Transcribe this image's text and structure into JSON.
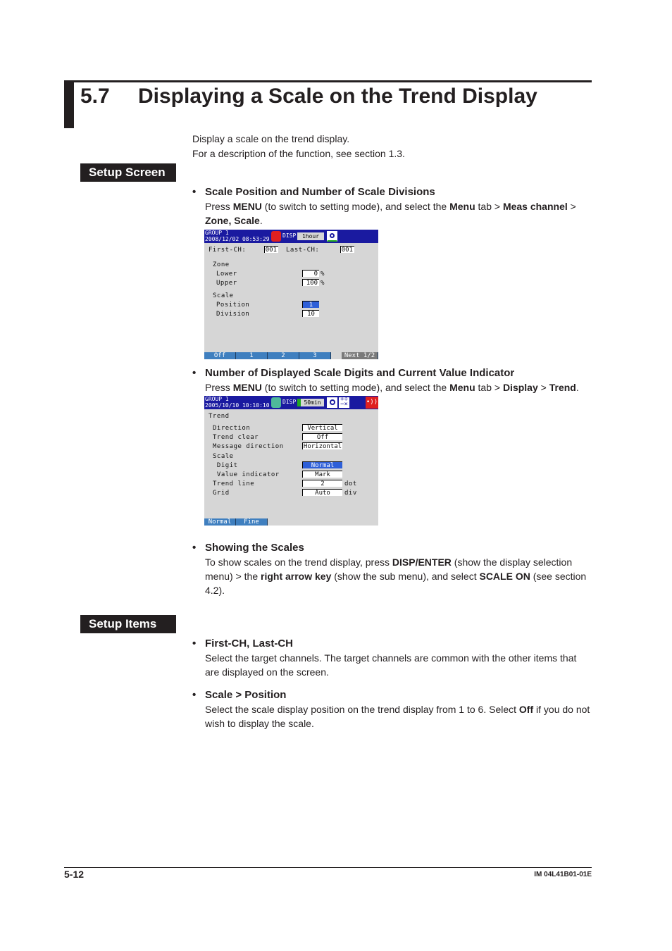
{
  "header": {
    "section_number": "5.7",
    "title": "Displaying a Scale on the Trend Display"
  },
  "intro": [
    "Display a scale on the trend display.",
    "For a description of the function, see section 1.3."
  ],
  "setup_screen": {
    "tag": "Setup Screen",
    "bullets": [
      {
        "heading": "Scale Position and Number of Scale Divisions",
        "text_parts": [
          "Press ",
          "MENU",
          " (to switch to setting mode), and select the ",
          "Menu",
          " tab > ",
          "Meas channel",
          " > ",
          "Zone, Scale",
          "."
        ]
      },
      {
        "heading": "Number of Displayed Scale Digits and Current Value Indicator",
        "text_parts": [
          "Press ",
          "MENU",
          " (to switch to setting mode), and select the ",
          "Menu",
          " tab > ",
          "Display",
          " > ",
          "Trend",
          "."
        ]
      },
      {
        "heading": "Showing the Scales",
        "text_parts": [
          "To show scales on the trend display, press ",
          "DISP/ENTER",
          " (show the display selection menu) > the ",
          "right arrow key",
          " (show the sub menu), and select ",
          "SCALE ON",
          " (see section 4.2)."
        ]
      }
    ]
  },
  "screen1": {
    "group": "GROUP 1",
    "datetime": "2008/12/02 08:53:29",
    "disp_label": "DISP",
    "time_div": "1hour",
    "first_ch_label": "First-CH:",
    "first_ch": "001",
    "last_ch_label": "Last-CH:",
    "last_ch": "001",
    "zone_label": "Zone",
    "lower_label": "Lower",
    "lower_value": "0",
    "upper_label": "Upper",
    "upper_value": "100",
    "percent": "%",
    "scale_label": "Scale",
    "position_label": "Position",
    "position_value": "1",
    "division_label": "Division",
    "division_value": "10",
    "softkeys": [
      "Off",
      "1",
      "2",
      "3",
      "Next 1/2"
    ]
  },
  "screen2": {
    "group": "GROUP 1",
    "datetime": "2005/10/10 10:10:10",
    "disp_label": "DISP",
    "time_div": "50min",
    "trend_label": "Trend",
    "rows": [
      {
        "label": "Direction",
        "value": "Vertical",
        "unit": "",
        "selected": false
      },
      {
        "label": "Trend clear",
        "value": "Off",
        "unit": "",
        "selected": false
      },
      {
        "label": "Message direction",
        "value": "Horizontal",
        "unit": "",
        "selected": false
      },
      {
        "label": "Scale",
        "value": null,
        "unit": "",
        "selected": false
      },
      {
        "label": " Digit",
        "value": "Normal",
        "unit": "",
        "selected": true
      },
      {
        "label": " Value indicator",
        "value": "Mark",
        "unit": "",
        "selected": false
      },
      {
        "label": "Trend line",
        "value": "2",
        "unit": "dot",
        "selected": false
      },
      {
        "label": "Grid",
        "value": "Auto",
        "unit": "div",
        "selected": false
      }
    ],
    "softkeys": [
      "Normal",
      "Fine"
    ]
  },
  "setup_items": {
    "tag": "Setup Items",
    "bullets": [
      {
        "heading": "First-CH, Last-CH",
        "text_parts": [
          "Select the target channels. The target channels are common with the other items that are displayed on the screen."
        ]
      },
      {
        "heading": "Scale > Position",
        "text_parts": [
          "Select the scale display position on the trend display from 1 to 6. Select ",
          "Off",
          " if you do not wish to display the scale."
        ]
      }
    ]
  },
  "footer": {
    "page": "5-12",
    "doc_id": "IM 04L41B01-01E"
  },
  "colors": {
    "screen_header": "#1a1aa0",
    "screen_bg": "#d6d6d6",
    "softkey": "#3f7fbf",
    "selected": "#2e5fd8"
  }
}
